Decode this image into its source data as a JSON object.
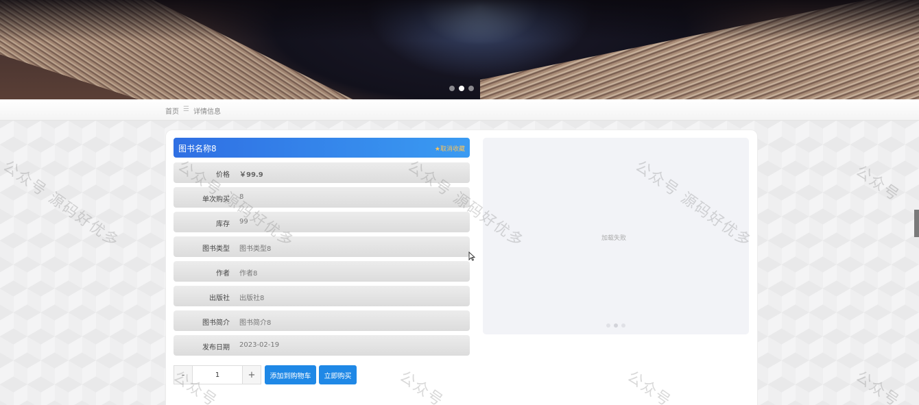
{
  "breadcrumb": {
    "home": "首页",
    "separator": "☰",
    "current": "详情信息"
  },
  "book": {
    "title": "图书名称8",
    "favorite_label": "★取消收藏",
    "fields": [
      {
        "label": "价格",
        "value": "￥99.9"
      },
      {
        "label": "单次购买",
        "value": "8"
      },
      {
        "label": "库存",
        "value": "99"
      },
      {
        "label": "图书类型",
        "value": "图书类型8"
      },
      {
        "label": "作者",
        "value": "作者8"
      },
      {
        "label": "出版社",
        "value": "出版社8"
      },
      {
        "label": "图书简介",
        "value": "图书简介8"
      },
      {
        "label": "发布日期",
        "value": "2023-02-19"
      }
    ]
  },
  "image_panel": {
    "status": "加载失败"
  },
  "purchase": {
    "minus": "-",
    "quantity": "1",
    "plus": "+",
    "add_to_cart": "添加到购物车",
    "buy_now": "立即购买"
  },
  "watermark": {
    "text_full": "公众号 源码好优多",
    "text_partial": "公众号"
  }
}
